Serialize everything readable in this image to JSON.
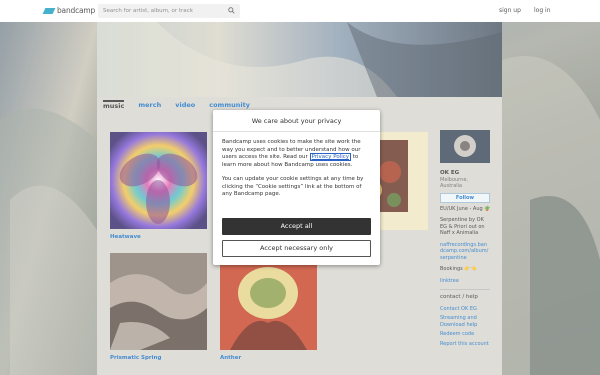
{
  "header": {
    "logo_text": "bandcamp",
    "search_placeholder": "Search for artist, album, or track",
    "signup_label": "sign up",
    "login_label": "log in"
  },
  "tabs": [
    {
      "label": "music",
      "active": true
    },
    {
      "label": "merch"
    },
    {
      "label": "video"
    },
    {
      "label": "community"
    }
  ],
  "albums": [
    {
      "title": "Heatwave"
    },
    {
      "title": ""
    },
    {
      "title": ""
    },
    {
      "title": "Prismatic Spring"
    },
    {
      "title": "Anther"
    }
  ],
  "artist": {
    "name": "OK EG",
    "location_line1": "Melbourne,",
    "location_line2": "Australia",
    "follow_label": "Follow",
    "tour": "EU/UK June - Aug 🪴",
    "desc_line1": "Serpentine by OK",
    "desc_line2": "EG & Priori out on",
    "desc_line3": "Naff x Animalia",
    "link1_line1": "naffrecordings.ban",
    "link1_line2": "dcamp.com/album/",
    "link1_line3": "serpentine",
    "bookings": "Bookings 👉👈",
    "linktree": "linktree"
  },
  "contact": {
    "heading": "contact / help",
    "links": [
      "Contact OK EG",
      "Streaming and",
      "Download help",
      "Redeem code",
      "Report this account"
    ]
  },
  "privacy": {
    "title": "We care about your privacy",
    "p1_before": "Bandcamp uses cookies to make the site work the way you expect and to better understand how our users access the site. Read our ",
    "p1_link": "Privacy Policy",
    "p1_after": " to learn more about how Bandcamp uses cookies.",
    "p2": "You can update your cookie settings at any time by clicking the “Cookie settings” link at the bottom of any Bandcamp page.",
    "accept_all_label": "Accept all",
    "accept_necessary_label": "Accept necessary only"
  },
  "colors": {
    "link": "#1a73c7",
    "accent": "#1da0c3",
    "button_dark": "#333333"
  }
}
